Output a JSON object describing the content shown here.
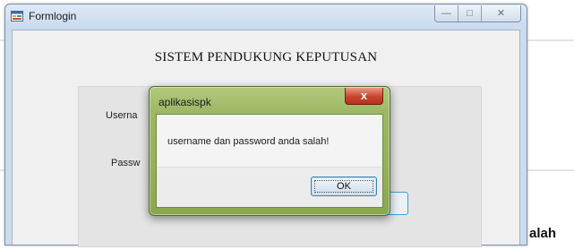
{
  "window": {
    "title": "Formlogin",
    "controls": {
      "minimize": "—",
      "maximize": "□",
      "close": "✕"
    },
    "heading": "SISTEM PENDUKUNG KEPUTUSAN",
    "form": {
      "username_label": "Userna",
      "password_label": "Passw"
    }
  },
  "dialog": {
    "title": "aplikasispk",
    "close_glyph": "x",
    "message": "username dan password anda salah!",
    "ok_label": "OK"
  },
  "outside_text": "alah",
  "colors": {
    "dialog_frame": "#9db865",
    "close_button": "#c8442d",
    "window_frame": "#cbdcef",
    "focus_border": "#3c9fe0"
  },
  "icons": [
    "app-form-icon",
    "minimize-icon",
    "maximize-icon",
    "close-icon",
    "dialog-close-icon"
  ]
}
